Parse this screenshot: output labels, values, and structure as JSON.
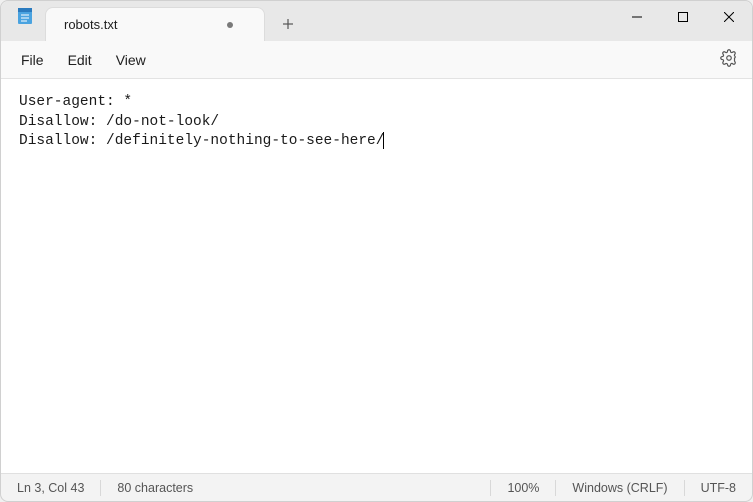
{
  "tab": {
    "title": "robots.txt"
  },
  "menu": {
    "file": "File",
    "edit": "Edit",
    "view": "View"
  },
  "content": {
    "line1": "User-agent: *",
    "line2": "Disallow: /do-not-look/",
    "line3": "Disallow: /definitely-nothing-to-see-here/"
  },
  "status": {
    "pos": "Ln 3, Col 43",
    "chars": "80 characters",
    "zoom": "100%",
    "eol": "Windows (CRLF)",
    "encoding": "UTF-8"
  }
}
